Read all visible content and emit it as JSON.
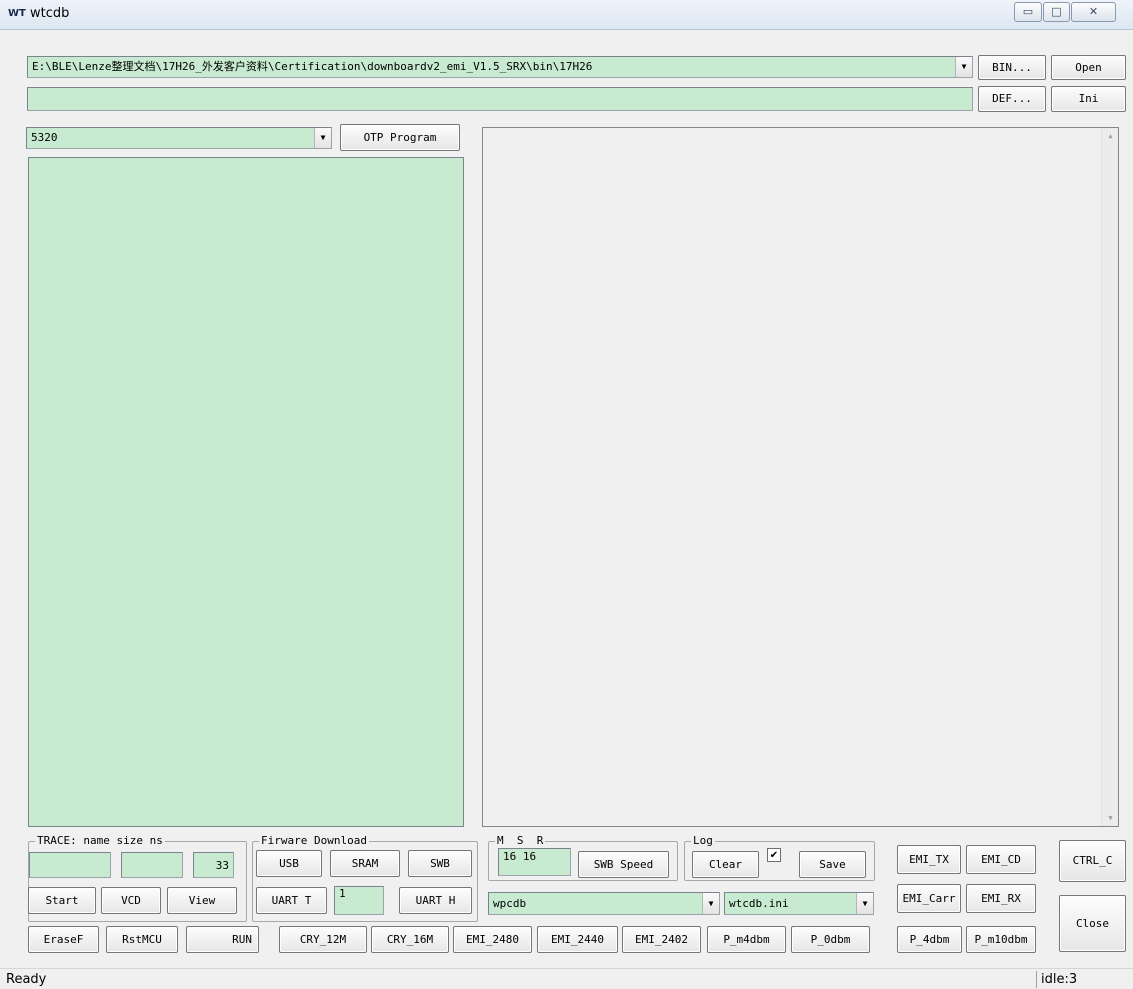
{
  "window": {
    "app_icon": "WT",
    "title": "wtcdb"
  },
  "controls": {
    "minimize": "▭",
    "maximize": "□",
    "close": "✕"
  },
  "path": {
    "value": "E:\\BLE\\Lenze整理文档\\17H26_外发客户资料\\Certification\\downboardv2_emi_V1.5_SRX\\bin\\17H26"
  },
  "def_field": {
    "value": ""
  },
  "top_buttons": {
    "bin": "BIN...",
    "open": "Open",
    "def": "DEF...",
    "ini": "Ini"
  },
  "chip_select": {
    "value": "5320"
  },
  "otp_button": "OTP Program",
  "scroll": {
    "up": "▲",
    "down": "▼"
  },
  "trace": {
    "title": "TRACE: name size ns",
    "field1": "",
    "field2": "",
    "field3": "33",
    "start": "Start",
    "vcd": "VCD",
    "view": "View"
  },
  "firmware": {
    "title": "Firware Download",
    "usb": "USB",
    "sram": "SRAM",
    "swb": "SWB",
    "uart_t": "UART T",
    "uart_value": "1",
    "uart_h": "UART H"
  },
  "msr": {
    "title": "M  S  R",
    "value": "16 16",
    "swb_speed": "SWB Speed"
  },
  "log": {
    "title": "Log",
    "clear": "Clear",
    "checkbox": "✔",
    "save": "Save"
  },
  "combos": {
    "wpcdb": "wpcdb",
    "ini_file": "wtcdb.ini"
  },
  "emi": {
    "tx": "EMI_TX",
    "cd": "EMI_CD",
    "carr": "EMI_Carr",
    "rx": "EMI_RX",
    "ctrl_c": "CTRL_C",
    "close": "Close"
  },
  "bottom_row": [
    "EraseF",
    "RstMCU",
    "RUN",
    "CRY_12M",
    "CRY_16M",
    "EMI_2480",
    "EMI_2440",
    "EMI_2402",
    "P_m4dbm",
    "P_0dbm",
    "P_4dbm",
    "P_m10dbm"
  ],
  "status": {
    "left": "Ready",
    "right": "idle:3"
  }
}
